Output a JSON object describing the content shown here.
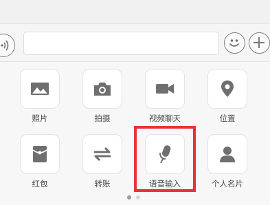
{
  "input_bar": {
    "voice_icon": "voice-wave-icon",
    "text_value": "",
    "emoji_icon": "smiley-icon",
    "plus_icon": "plus-icon"
  },
  "panel": {
    "items": [
      {
        "label": "照片",
        "icon": "photo-icon"
      },
      {
        "label": "拍摄",
        "icon": "camera-icon"
      },
      {
        "label": "视频聊天",
        "icon": "video-camera-icon"
      },
      {
        "label": "位置",
        "icon": "location-pin-icon"
      },
      {
        "label": "红包",
        "icon": "red-packet-icon"
      },
      {
        "label": "转账",
        "icon": "transfer-arrows-icon"
      },
      {
        "label": "语音输入",
        "icon": "microphone-icon"
      },
      {
        "label": "个人名片",
        "icon": "contact-card-icon"
      }
    ],
    "highlighted_item": "语音输入",
    "pages": 2,
    "current_page": 1
  },
  "colors": {
    "icon": "#6f6f6f",
    "highlight": "#e8323a",
    "dot_active": "#9a9a9a",
    "dot_inactive": "#d6d6d6"
  }
}
